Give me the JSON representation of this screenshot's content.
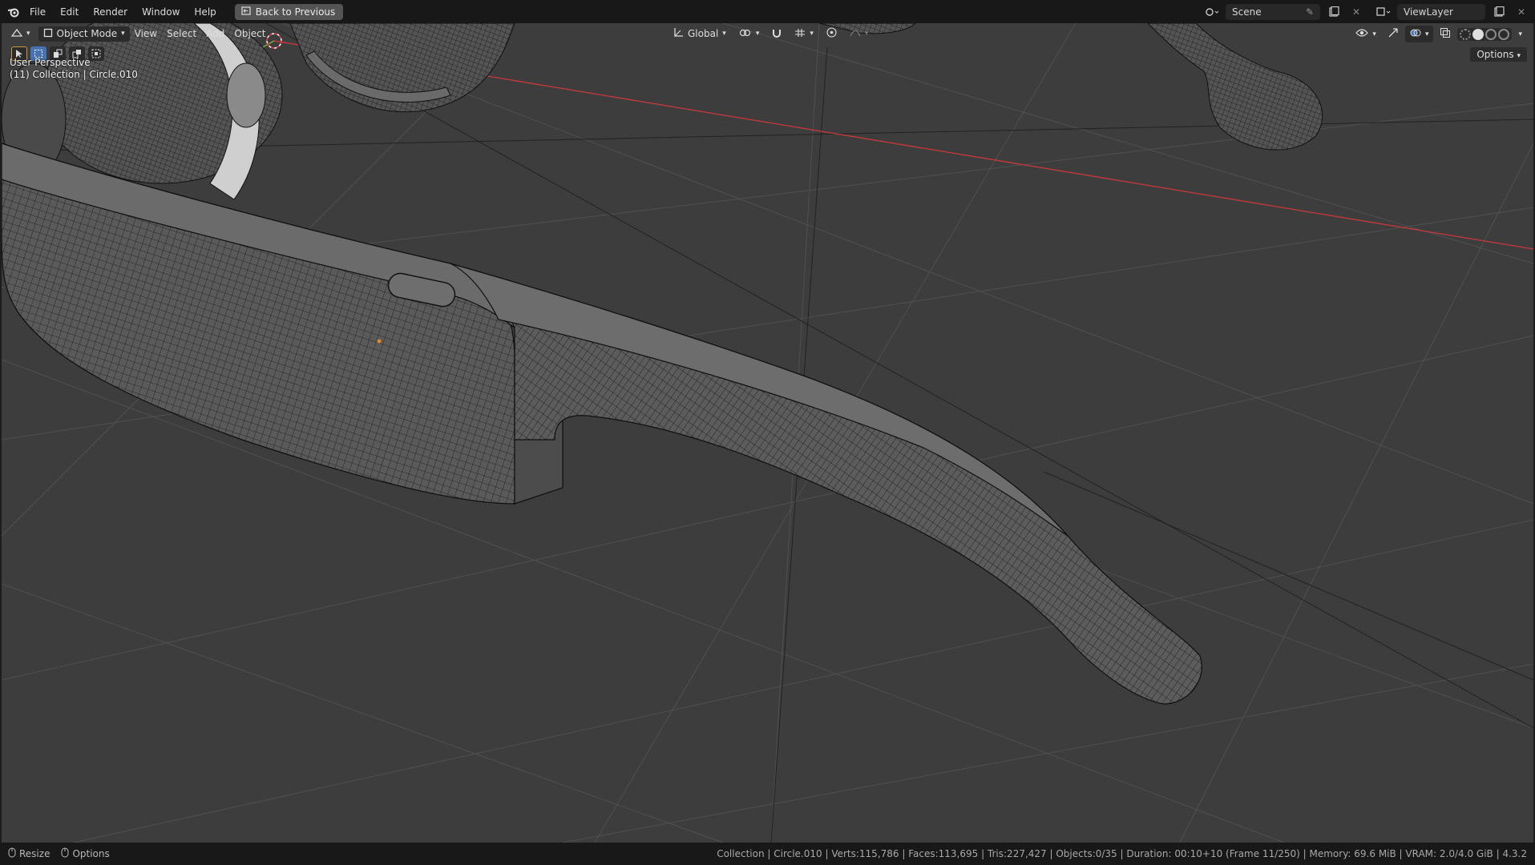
{
  "menu": {
    "items": [
      "File",
      "Edit",
      "Render",
      "Window",
      "Help"
    ],
    "back_button": "Back to Previous"
  },
  "topbar_right": {
    "scene": "Scene",
    "view_layer": "ViewLayer"
  },
  "viewport_header": {
    "mode": "Object Mode",
    "view": "View",
    "select": "Select",
    "add": "Add",
    "object": "Object",
    "orientation": "Global",
    "options": "Options"
  },
  "viewport_overlay": {
    "perspective": "User Perspective",
    "collection_info": "(11) Collection | Circle.010"
  },
  "statusbar": {
    "resize": "Resize",
    "options": "Options",
    "stats": "Collection | Circle.010 | Verts:115,786 | Faces:113,695 | Tris:227,427 | Objects:0/35 | Duration: 00:10+10 (Frame 11/250) | Memory: 69.6 MiB | VRAM: 2.0/4.0 GiB | 4.3.2"
  },
  "colors": {
    "viewport_bg": "#3d3d3d",
    "x_axis": "#c0393d",
    "y_axis": "#7fae3c",
    "accent": "#4772b3"
  }
}
